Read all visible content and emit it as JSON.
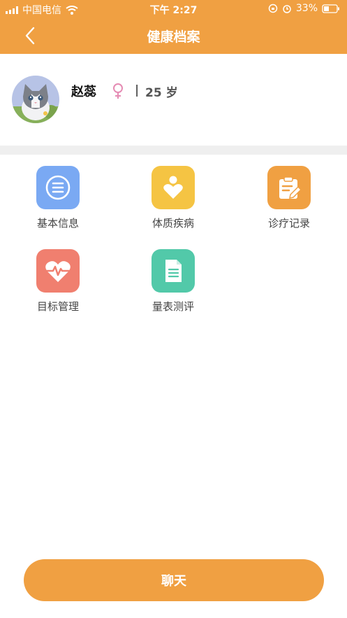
{
  "status_bar": {
    "carrier": "中国电信",
    "time": "下午 2:27",
    "battery": "33%"
  },
  "nav": {
    "title": "健康档案"
  },
  "profile": {
    "name": "赵蕊",
    "separator": "|",
    "age": "25 岁",
    "gender_icon": "female-icon"
  },
  "menu": [
    {
      "label": "基本信息",
      "icon": "list-icon",
      "color": "#7aa9f3"
    },
    {
      "label": "体质疾病",
      "icon": "person-heart-icon",
      "color": "#f5c443"
    },
    {
      "label": "诊疗记录",
      "icon": "clipboard-edit-icon",
      "color": "#f0a042"
    },
    {
      "label": "目标管理",
      "icon": "heart-pulse-icon",
      "color": "#f07f6f"
    },
    {
      "label": "量表测评",
      "icon": "document-icon",
      "color": "#52c9a9"
    }
  ],
  "chat_button": {
    "label": "聊天"
  },
  "colors": {
    "accent": "#f0a042",
    "divider": "#efefef"
  }
}
